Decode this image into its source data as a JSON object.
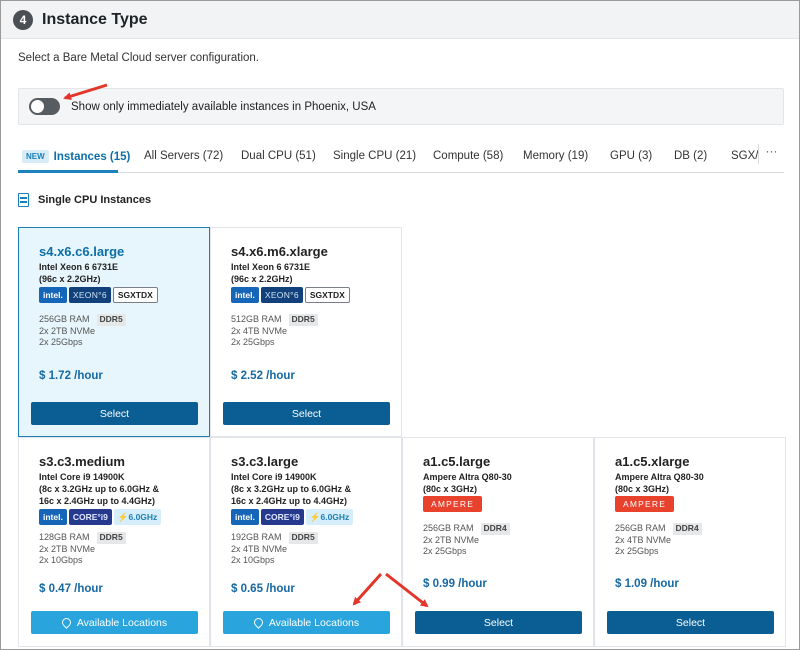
{
  "header": {
    "step": "4",
    "title": "Instance Type"
  },
  "subtitle": "Select a Bare Metal Cloud server configuration.",
  "toggle": {
    "on": false,
    "label": "Show only immediately available instances in Phoenix, USA"
  },
  "tabs": [
    {
      "badge": "NEW",
      "label": "Instances (15)",
      "active": true
    },
    {
      "label": "All Servers (72)"
    },
    {
      "label": "Dual CPU (51)"
    },
    {
      "label": "Single CPU (21)"
    },
    {
      "label": "Compute (58)"
    },
    {
      "label": "Memory (19)"
    },
    {
      "label": "GPU (3)"
    },
    {
      "label": "DB (2)"
    },
    {
      "label": "SGX/"
    }
  ],
  "tabs_more": "···",
  "section_title": "Single CPU Instances",
  "cards": [
    {
      "name": "s4.x6.c6.large",
      "cpu": "Intel Xeon 6 6731E",
      "cores": [
        "(96c x 2.2GHz)"
      ],
      "badges": [
        {
          "kind": "intel",
          "text": "intel."
        },
        {
          "kind": "xeon",
          "text": "XEON°6"
        },
        {
          "kind": "tag",
          "text": "SGXTDX"
        }
      ],
      "ram": "256GB RAM",
      "ddr": "DDR5",
      "storage": "2x 2TB NVMe",
      "network": "2x 25Gbps",
      "price": "$ 1.72 /hour",
      "button": "Select",
      "button_kind": "select",
      "selected": true
    },
    {
      "name": "s4.x6.m6.xlarge",
      "cpu": "Intel Xeon 6 6731E",
      "cores": [
        "(96c x 2.2GHz)"
      ],
      "badges": [
        {
          "kind": "intel",
          "text": "intel."
        },
        {
          "kind": "xeon",
          "text": "XEON°6"
        },
        {
          "kind": "tag",
          "text": "SGXTDX"
        }
      ],
      "ram": "512GB RAM",
      "ddr": "DDR5",
      "storage": "2x 4TB NVMe",
      "network": "2x 25Gbps",
      "price": "$ 2.52 /hour",
      "button": "Select",
      "button_kind": "select",
      "selected": false
    },
    {
      "name": "s3.c3.medium",
      "cpu": "Intel Core i9 14900K",
      "cores": [
        "(8c x 3.2GHz up to 6.0GHz &",
        "16c x 2.4GHz up to 4.4GHz)"
      ],
      "badges": [
        {
          "kind": "intel",
          "text": "intel."
        },
        {
          "kind": "core",
          "text": "CORE°i9"
        },
        {
          "kind": "speed",
          "text": "⚡6.0GHz"
        }
      ],
      "ram": "128GB RAM",
      "ddr": "DDR5",
      "storage": "2x 2TB NVMe",
      "network": "2x 10Gbps",
      "price": "$ 0.47 /hour",
      "button": "Available Locations",
      "button_kind": "locations",
      "selected": false
    },
    {
      "name": "s3.c3.large",
      "cpu": "Intel Core i9 14900K",
      "cores": [
        "(8c x 3.2GHz up to 6.0GHz &",
        "16c x 2.4GHz up to 4.4GHz)"
      ],
      "badges": [
        {
          "kind": "intel",
          "text": "intel."
        },
        {
          "kind": "core",
          "text": "CORE°i9"
        },
        {
          "kind": "speed",
          "text": "⚡6.0GHz"
        }
      ],
      "ram": "192GB RAM",
      "ddr": "DDR5",
      "storage": "2x 4TB NVMe",
      "network": "2x 10Gbps",
      "price": "$ 0.65 /hour",
      "button": "Available Locations",
      "button_kind": "locations",
      "selected": false
    },
    {
      "name": "a1.c5.large",
      "cpu": "Ampere Altra Q80-30",
      "cores": [
        "(80c x 3GHz)"
      ],
      "badges": [
        {
          "kind": "ampere",
          "text": "AMPERE"
        }
      ],
      "ram": "256GB RAM",
      "ddr": "DDR4",
      "storage": "2x 2TB NVMe",
      "network": "2x 25Gbps",
      "price": "$ 0.99 /hour",
      "button": "Select",
      "button_kind": "select",
      "selected": false
    },
    {
      "name": "a1.c5.xlarge",
      "cpu": "Ampere Altra Q80-30",
      "cores": [
        "(80c x 3GHz)"
      ],
      "badges": [
        {
          "kind": "ampere",
          "text": "AMPERE"
        }
      ],
      "ram": "256GB RAM",
      "ddr": "DDR4",
      "storage": "2x 4TB NVMe",
      "network": "2x 25Gbps",
      "price": "$ 1.09 /hour",
      "button": "Select",
      "button_kind": "select",
      "selected": false
    }
  ],
  "colors": {
    "accent": "#0d6fa8",
    "button": "#0b5e93",
    "locations_button": "#29a4dc",
    "selected_bg": "#e6f6fc",
    "annotation_arrow": "#e2362a"
  },
  "annotations": [
    {
      "type": "arrow",
      "target": "availability-toggle"
    },
    {
      "type": "arrow",
      "target": "available-locations-button"
    },
    {
      "type": "arrow",
      "target": "select-button"
    }
  ]
}
